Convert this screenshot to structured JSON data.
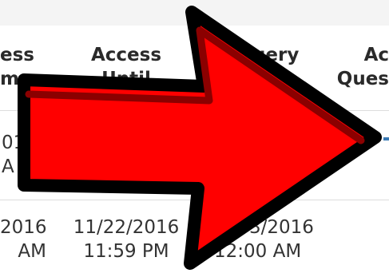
{
  "table": {
    "headers": [
      {
        "line1": "ess",
        "line2": "m"
      },
      {
        "line1": "Access",
        "line2": "Until"
      },
      {
        "line1": "uery",
        "line2": ""
      },
      {
        "line1": "Ac",
        "line2": "Ques"
      }
    ],
    "rows": [
      {
        "c0_line1": "01",
        "c0_line2": "A"
      },
      {
        "c0_line1": "2016",
        "c0_line2": "AM",
        "c1_line1": "11/22/2016",
        "c1_line2": "11:59 PM",
        "c2_line1": "3/2016",
        "c2_line2": "12:00 AM"
      }
    ]
  },
  "overlay": {
    "arrow_icon": "right-arrow-icon",
    "arrow_fill": "#ff0000",
    "arrow_shade": "#8b0000",
    "arrow_outline": "#000000"
  }
}
